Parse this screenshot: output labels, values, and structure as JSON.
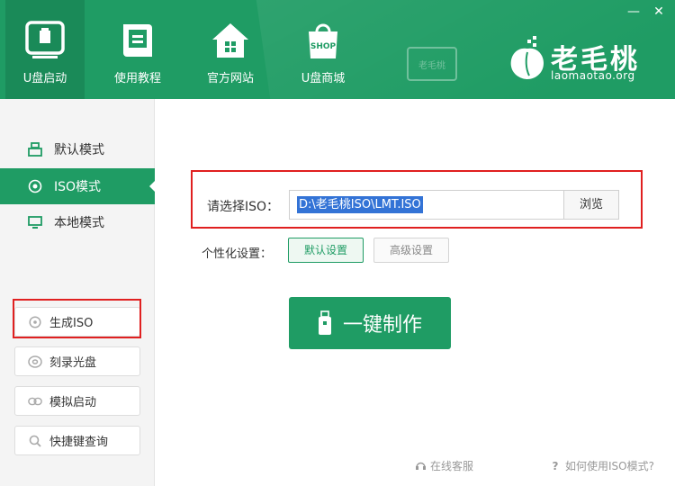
{
  "nav": {
    "items": [
      {
        "label": "U盘启动",
        "icon": "usb-drive-icon"
      },
      {
        "label": "使用教程",
        "icon": "book-icon"
      },
      {
        "label": "官方网站",
        "icon": "home-icon"
      },
      {
        "label": "U盘商城",
        "icon": "shop-bag-icon",
        "badge": "SHOP"
      }
    ]
  },
  "window": {
    "minimize": "—",
    "close": "✕"
  },
  "brand": {
    "name": "老毛桃",
    "domain": "laomaotao.org",
    "watermark": "老毛桃"
  },
  "sidebar": {
    "modes": [
      {
        "label": "默认模式",
        "icon": "usb-icon"
      },
      {
        "label": "ISO模式",
        "icon": "disc-radio-icon"
      },
      {
        "label": "本地模式",
        "icon": "monitor-icon"
      }
    ],
    "tools": [
      {
        "label": "生成ISO",
        "icon": "disc-icon"
      },
      {
        "label": "刻录光盘",
        "icon": "burn-disc-icon"
      },
      {
        "label": "模拟启动",
        "icon": "link-icon"
      },
      {
        "label": "快捷键查询",
        "icon": "search-icon"
      }
    ]
  },
  "iso": {
    "label": "请选择ISO：",
    "path": "D:\\老毛桃ISO\\LMT.ISO",
    "browse": "浏览"
  },
  "personalize": {
    "label": "个性化设置：",
    "default_btn": "默认设置",
    "advanced_btn": "高级设置"
  },
  "make_button": "一键制作",
  "footer": {
    "service": "在线客服",
    "help": "如何使用ISO模式?"
  },
  "colors": {
    "brand_green": "#1f9c64",
    "highlight_red": "#e02020",
    "selection_blue": "#3373d6"
  }
}
